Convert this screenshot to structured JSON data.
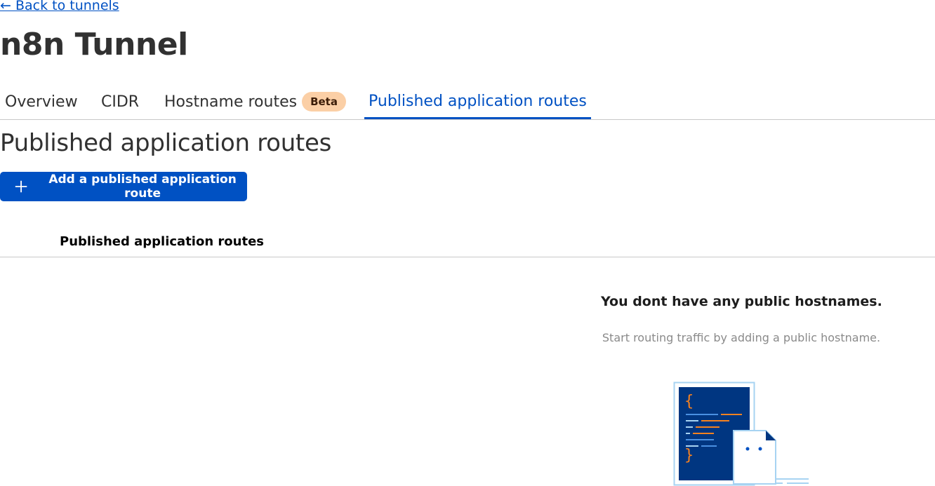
{
  "nav": {
    "back_link": "← Back to tunnels"
  },
  "page": {
    "title": "n8n Tunnel"
  },
  "tabs": [
    {
      "label": "Overview",
      "active": false
    },
    {
      "label": "CIDR",
      "active": false
    },
    {
      "label": "Hostname routes",
      "badge": "Beta",
      "active": false
    },
    {
      "label": "Published application routes",
      "active": true
    }
  ],
  "section": {
    "title": "Published application routes",
    "add_button_label": "Add a published application route"
  },
  "table": {
    "columns": [
      "Published application routes"
    ]
  },
  "empty_state": {
    "title": "You dont have any public hostnames.",
    "subtitle": "Start routing traffic by adding a public hostname.",
    "illustration_icon": "code-document-icon"
  },
  "colors": {
    "accent": "#0051c3",
    "badge_bg": "#fbcfa6",
    "illustration_dark": "#003681",
    "illustration_light": "#a7d3f2",
    "code_orange": "#f6821f"
  }
}
